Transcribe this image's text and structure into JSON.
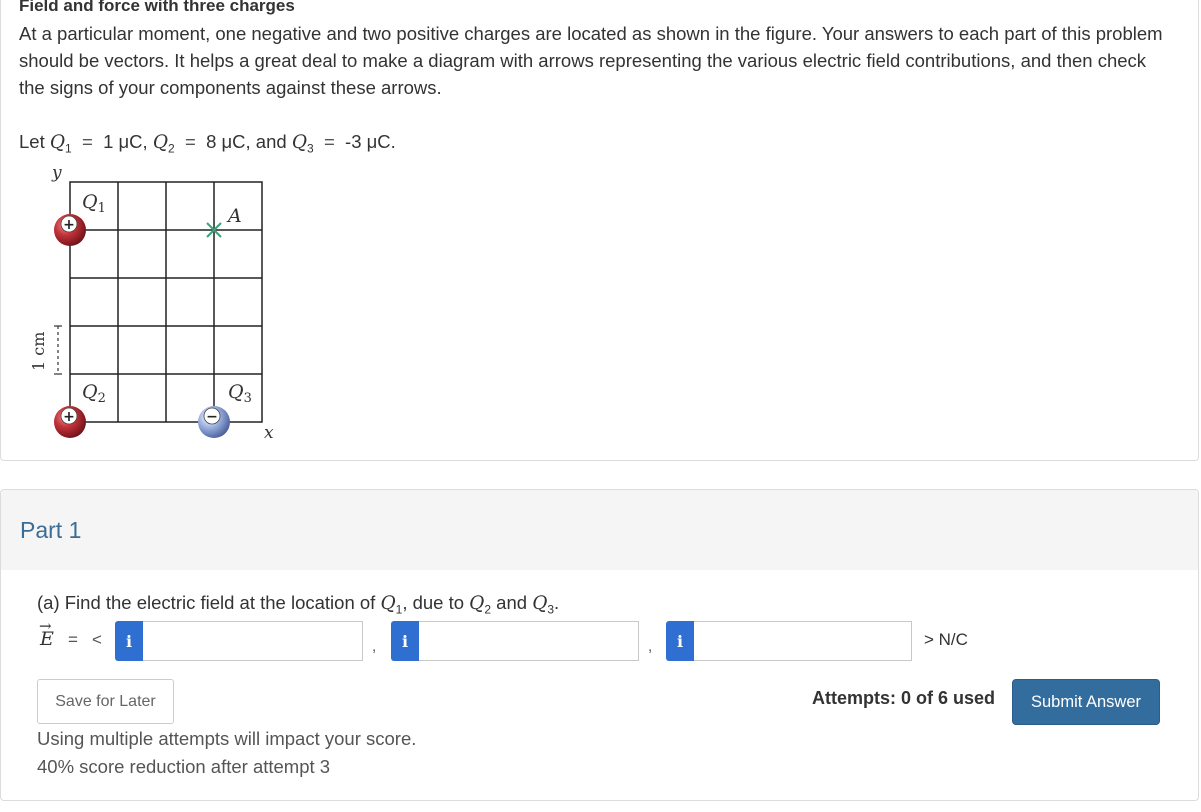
{
  "problem": {
    "title": "Field and force with three charges",
    "intro": "At a particular moment, one negative and two positive charges are located as shown in the figure. Your answers to each part of this problem should be vectors. It helps a great deal to make a diagram with arrows representing the various electric field contributions, and then check the signs of your components against these arrows.",
    "given": {
      "prefix": "Let",
      "q1_label": "Q",
      "q1_sub": "1",
      "q1_value": "1 μC,",
      "q2_label": "Q",
      "q2_sub": "2",
      "q2_value": "8 μC,",
      "and_text": "and",
      "q3_label": "Q",
      "q3_sub": "3",
      "q3_value": "-3 μC."
    },
    "figure": {
      "y_axis": "y",
      "x_axis": "x",
      "scale_label": "1 cm",
      "q1_label": "Q",
      "q1_sub": "1",
      "q2_label": "Q",
      "q2_sub": "2",
      "q3_label": "Q",
      "q3_sub": "3",
      "point_label": "A",
      "plus_sign": "+",
      "minus_sign": "−"
    }
  },
  "part": {
    "title": "Part 1",
    "question": {
      "prefix": "(a) Find the electric field at the location of",
      "q1_label": "Q",
      "q1_sub": "1",
      "middle": ", due to",
      "q2_label": "Q",
      "q2_sub": "2",
      "and_text": "and",
      "q3_label": "Q",
      "q3_sub": "3",
      "suffix": "."
    },
    "vector_symbol": "E",
    "vector_arrow": "→",
    "equals": "=",
    "open_bracket": "<",
    "info_label": "i",
    "inputs": [
      {
        "value": "",
        "placeholder": ""
      },
      {
        "value": "",
        "placeholder": ""
      },
      {
        "value": "",
        "placeholder": ""
      }
    ],
    "separator": ",",
    "units": "> N/C",
    "save_label": "Save for Later",
    "attempts": "Attempts: 0 of 6 used",
    "submit_label": "Submit Answer",
    "note1": "Using multiple attempts will impact your score.",
    "note2": "40% score reduction after attempt 3"
  },
  "colors": {
    "positive_charge": "#b3242c",
    "negative_charge": "#8fa5d8",
    "info_button": "#2f6fd1",
    "submit_button": "#336d9d",
    "part_title": "#3a6d96",
    "point_marker": "#3aa37a"
  }
}
